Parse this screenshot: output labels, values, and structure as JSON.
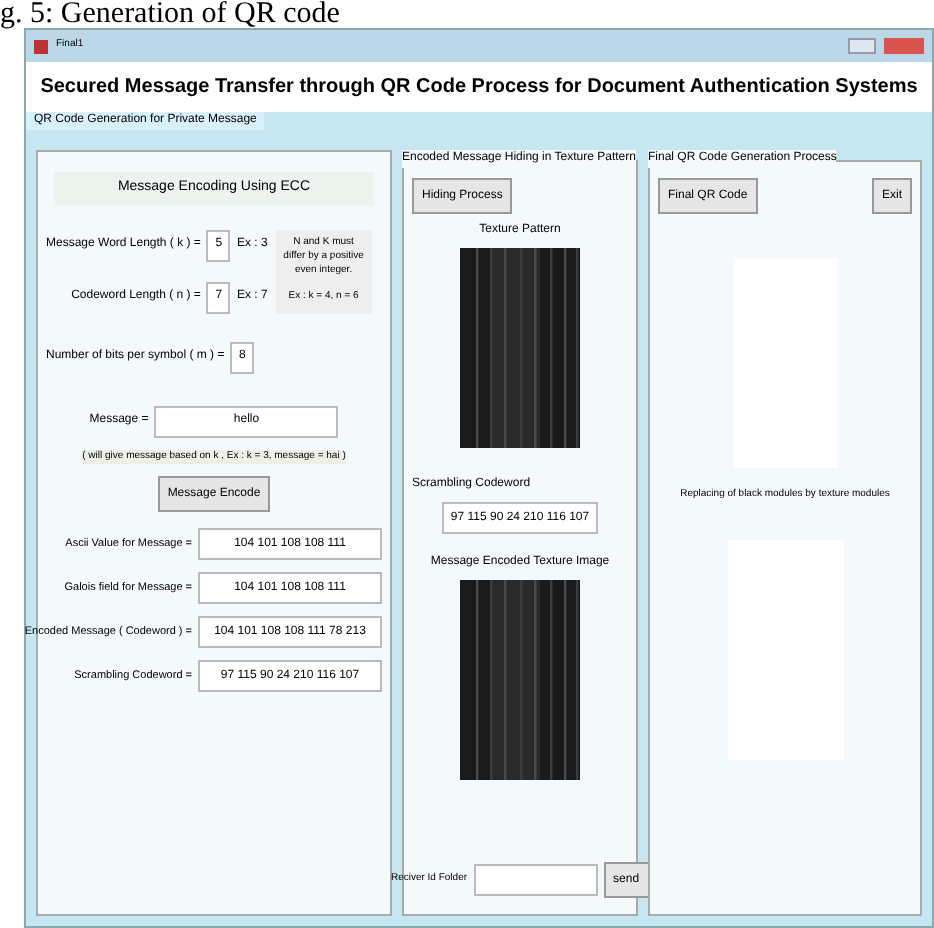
{
  "caption": "g. 5: Generation of QR code",
  "window": {
    "title": "Final1"
  },
  "header": "Secured  Message Transfer through QR Code Process for Document Authentication Systems",
  "group_title": "QR Code Generation for Private Message",
  "encoding": {
    "title": "Message Encoding Using ECC",
    "k": {
      "label": "Message Word Length ( k ) =",
      "value": "5",
      "example": "Ex : 3"
    },
    "n": {
      "label": "Codeword Length ( n ) =",
      "value": "7",
      "example": "Ex : 7"
    },
    "note": "N and K must differ by a positive even integer.",
    "note_example": "Ex : k = 4, n = 6",
    "m": {
      "label": "Number of bits per symbol ( m ) =",
      "value": "8"
    },
    "message": {
      "label": "Message =",
      "value": "hello"
    },
    "hint": "( will give message based on k , Ex : k = 3, message = hai )",
    "button": "Message Encode",
    "outputs": [
      {
        "label": "Ascii Value for Message =",
        "value": "104 101 108 108 111"
      },
      {
        "label": "Galois field for Message =",
        "value": "104 101 108 108 111"
      },
      {
        "label": "Encoded Message ( Codeword ) =",
        "value": "104 101 108 108 111 78 213"
      },
      {
        "label": "Scrambling Codeword =",
        "value": "97 115 90 24 210 116 107"
      }
    ]
  },
  "hiding": {
    "title": "Encoded Message Hiding in Texture Pattern",
    "button": "Hiding Process",
    "texture_label": "Texture Pattern",
    "scrambling_label": "Scrambling Codeword",
    "scrambling_value": "97 115 90 24 210 116 107",
    "encoded_label": "Message Encoded Texture Image",
    "folder_label": "Reciver Id Folder",
    "send": "send"
  },
  "final": {
    "title": "Final QR Code Generation Process",
    "button": "Final QR Code",
    "exit": "Exit",
    "replace_label": "Replacing of black modules by texture modules"
  }
}
